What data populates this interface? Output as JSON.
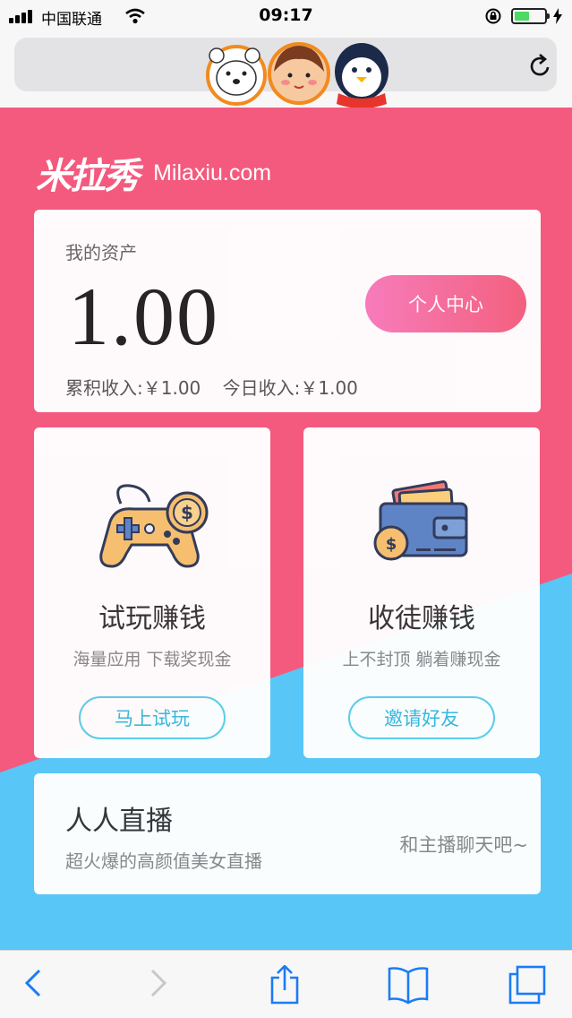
{
  "status_bar": {
    "carrier": "中国联通",
    "time": "09:17"
  },
  "browser": {
    "reload_icon": "reload-icon"
  },
  "brand": {
    "logo": "米拉秀",
    "domain": "Milaxiu.com"
  },
  "asset": {
    "label": "我的资产",
    "value": "1.00",
    "center_button": "个人中心",
    "total_income": "累积收入:￥1.00",
    "today_income": "今日收入:￥1.00"
  },
  "tasks": [
    {
      "title": "试玩赚钱",
      "subtitle": "海量应用 下载奖现金",
      "button": "马上试玩",
      "icon": "gamepad-coin-icon"
    },
    {
      "title": "收徒赚钱",
      "subtitle": "上不封顶 躺着赚现金",
      "button": "邀请好友",
      "icon": "wallet-coin-icon"
    }
  ],
  "live": {
    "title": "人人直播",
    "subtitle": "超火爆的高颜值美女直播",
    "chat": "和主播聊天吧~"
  },
  "colors": {
    "pink": "#f45a7e",
    "blue": "#58c6f7",
    "accent_gradient_start": "#f87dbd",
    "accent_gradient_end": "#f3617f",
    "outline_button": "#37b8de"
  },
  "toolbar": [
    "back-icon",
    "forward-icon",
    "share-icon",
    "bookmarks-icon",
    "tabs-icon"
  ]
}
